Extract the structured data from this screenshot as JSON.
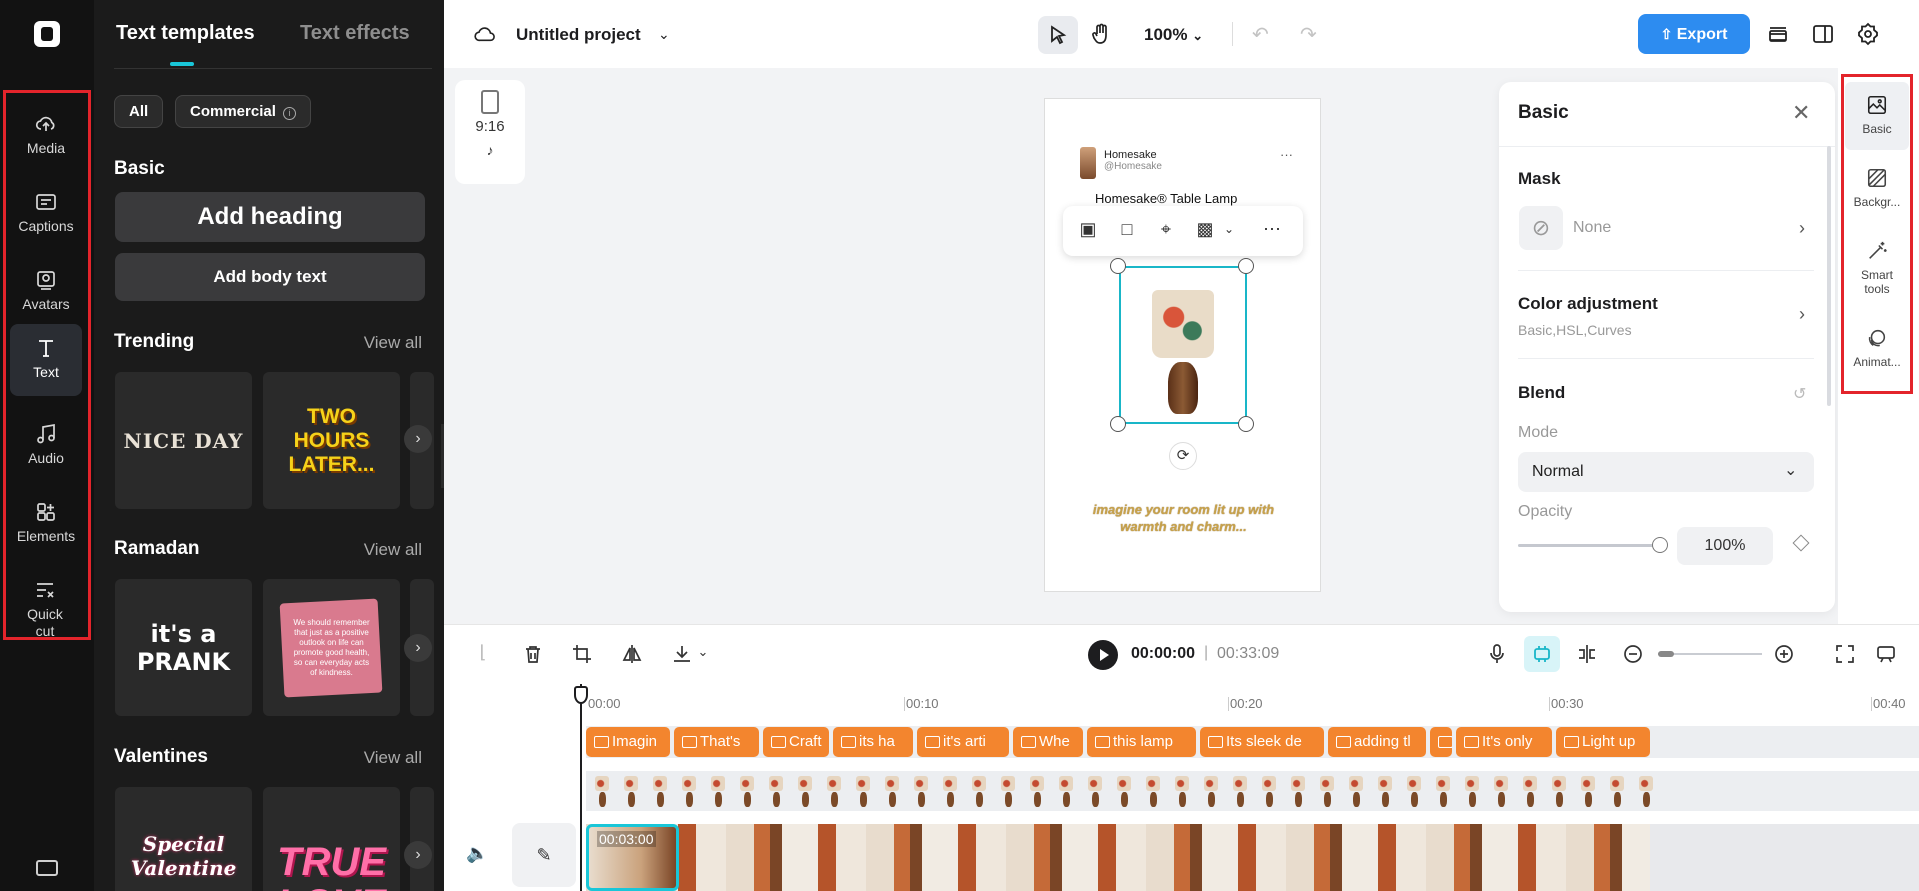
{
  "sidebar": {
    "items": [
      {
        "label": "Media",
        "icon": "cloud-upload-icon"
      },
      {
        "label": "Captions",
        "icon": "captions-icon"
      },
      {
        "label": "Avatars",
        "icon": "avatar-icon"
      },
      {
        "label": "Text",
        "icon": "text-icon",
        "active": true
      },
      {
        "label": "Audio",
        "icon": "music-icon"
      },
      {
        "label": "Elements",
        "icon": "elements-icon"
      },
      {
        "label": "Quick cut",
        "icon": "quick-cut-icon"
      }
    ]
  },
  "panel": {
    "tabs": [
      "Text templates",
      "Text effects"
    ],
    "filters": [
      "All",
      "Commercial"
    ],
    "basic_heading": "Basic",
    "add_heading": "Add heading",
    "add_body": "Add body text",
    "sections": [
      {
        "title": "Trending",
        "view_all": "View all",
        "cards": [
          "NICE DAY",
          "TWO HOURS LATER..."
        ]
      },
      {
        "title": "Ramadan",
        "view_all": "View all",
        "cards": [
          "it's a PRANK",
          "We should remember that just as a positive outlook on life can promote good health, so can everyday acts of kindness."
        ]
      },
      {
        "title": "Valentines",
        "view_all": "View all",
        "cards": [
          "Special Valentine",
          "TRUE LOVE"
        ]
      }
    ]
  },
  "topbar": {
    "project_title": "Untitled project",
    "zoom": "100%",
    "export_label": "Export"
  },
  "canvas": {
    "ratio": "9:16",
    "post": {
      "brand": "Homesake",
      "handle": "@Homesake",
      "headline": "Homesake® Table Lamp",
      "caption": "imagine your room lit up with warmth and charm..."
    }
  },
  "properties": {
    "title": "Basic",
    "mask_label": "Mask",
    "mask_value": "None",
    "color_adjustment_label": "Color adjustment",
    "color_adjustment_sub": "Basic,HSL,Curves",
    "blend_label": "Blend",
    "mode_label": "Mode",
    "mode_value": "Normal",
    "opacity_label": "Opacity",
    "opacity_value": "100%",
    "opacity_level": 1.0
  },
  "right_tabs": [
    {
      "label": "Basic",
      "icon": "image-adjust-icon"
    },
    {
      "label": "Backgr...",
      "icon": "background-icon"
    },
    {
      "label": "Smart tools",
      "icon": "magic-wand-icon"
    },
    {
      "label": "Animat...",
      "icon": "animation-icon"
    }
  ],
  "timeline": {
    "current_time": "00:00:00",
    "separator": "|",
    "total_time": "00:33:09",
    "ruler": [
      "00:00",
      "00:10",
      "00:20",
      "00:30",
      "00:40"
    ],
    "first_clip_label": "00:03:00",
    "captions": [
      "Imagin",
      "That's",
      "Craft",
      "its ha",
      "it's arti",
      "Whe",
      "this lamp",
      "Its sleek de",
      "adding tl",
      "",
      "It's only",
      "Light up"
    ]
  },
  "colors": {
    "accent": "#19c6d8",
    "export": "#2d8cf0",
    "caption_clip": "#f3852e",
    "highlight_box": "#e3242b"
  }
}
